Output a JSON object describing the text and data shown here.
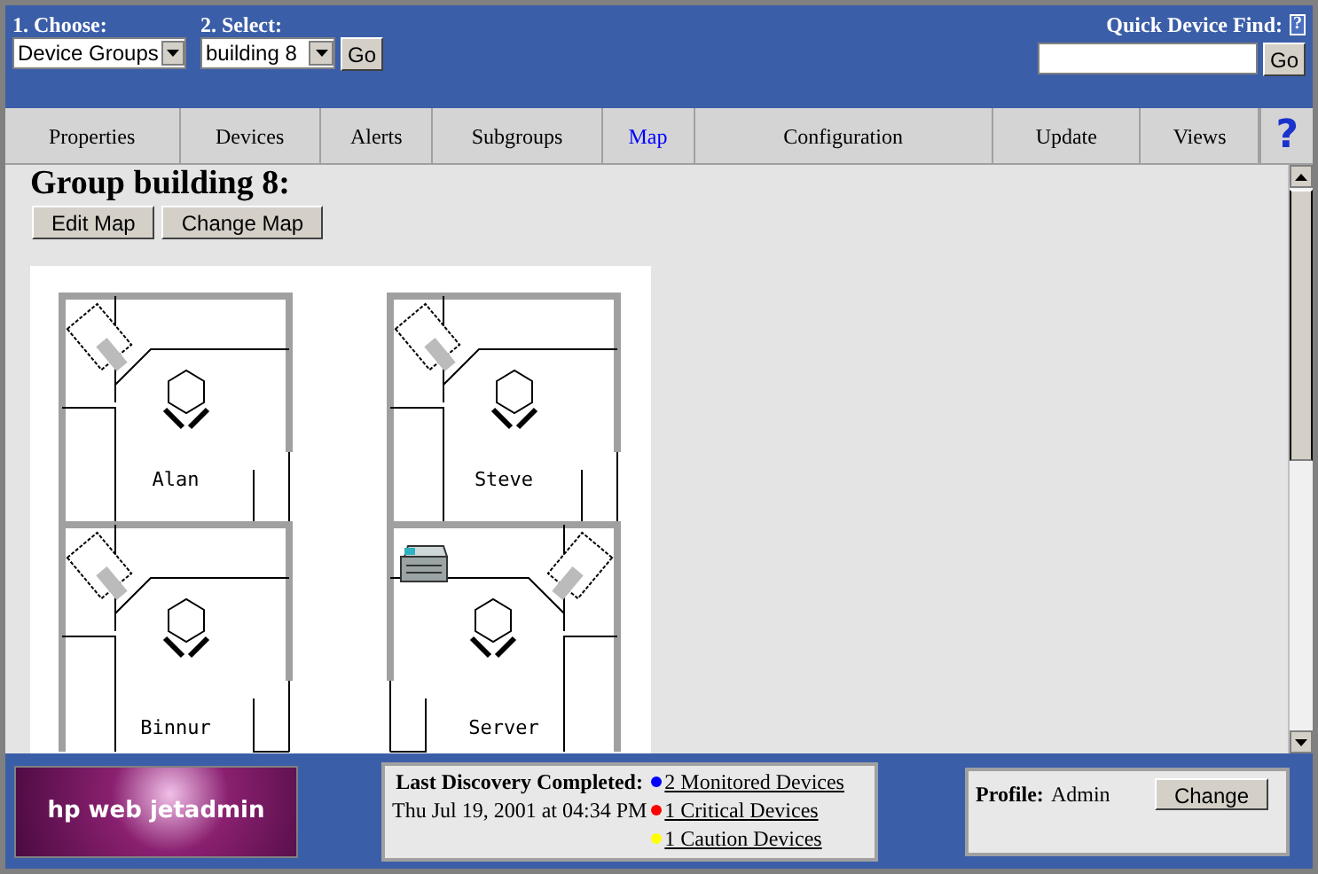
{
  "header": {
    "choose": {
      "label": "1. Choose:",
      "value": "Device Groups"
    },
    "select": {
      "label": "2. Select:",
      "value": "building 8"
    },
    "go_button": "Go",
    "quick_find": {
      "label": "Quick Device Find:",
      "help": "?",
      "button": "Go"
    }
  },
  "tabs": [
    {
      "label": "Properties",
      "selected": false
    },
    {
      "label": "Devices",
      "selected": false
    },
    {
      "label": "Alerts",
      "selected": false
    },
    {
      "label": "Subgroups",
      "selected": false
    },
    {
      "label": "Map",
      "selected": true
    },
    {
      "label": "Configuration",
      "selected": false
    },
    {
      "label": "Update",
      "selected": false
    },
    {
      "label": "Views",
      "selected": false
    }
  ],
  "help": "?",
  "page": {
    "title": "Group building 8:",
    "buttons": [
      "Edit Map",
      "Change Map"
    ],
    "map": {
      "rooms": [
        {
          "name": "Alan",
          "mirrored": false,
          "printer": false
        },
        {
          "name": "Steve",
          "mirrored": false,
          "printer": false
        },
        {
          "name": "Binnur",
          "mirrored": false,
          "printer": false
        },
        {
          "name": "Server",
          "mirrored": true,
          "printer": true
        }
      ]
    }
  },
  "footer": {
    "logo": "hp web jetadmin",
    "discovery": {
      "label": "Last Discovery Completed:",
      "time": "Thu Jul 19, 2001 at 04:34 PM",
      "links": [
        {
          "text": "2 Monitored Devices",
          "color": "#0000ff"
        },
        {
          "text": "1 Critical Devices",
          "color": "#ff0000"
        },
        {
          "text": "1 Caution Devices",
          "color": "#ffff00"
        }
      ]
    },
    "profile": {
      "label": "Profile:",
      "value": "Admin",
      "button": "Change"
    }
  }
}
